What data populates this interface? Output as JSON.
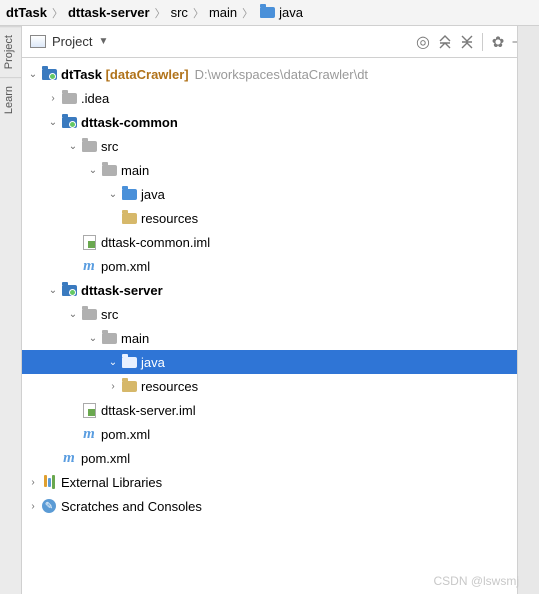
{
  "breadcrumb": [
    {
      "label": "dtTask",
      "bold": true,
      "icon": null
    },
    {
      "label": "dttask-server",
      "bold": true,
      "icon": null
    },
    {
      "label": "src",
      "bold": false,
      "icon": null
    },
    {
      "label": "main",
      "bold": false,
      "icon": null
    },
    {
      "label": "java",
      "bold": false,
      "icon": "folder-blue"
    }
  ],
  "sideTabs": [
    "Project",
    "Learn"
  ],
  "panel": {
    "title": "Project"
  },
  "tree": {
    "root": {
      "label": "dtTask",
      "bracket": "[dataCrawler]",
      "path": "D:\\workspaces\\dataCrawler\\dt"
    },
    "idea": ".idea",
    "dttask_common": "dttask-common",
    "common_src": "src",
    "common_main": "main",
    "common_java": "java",
    "common_resources": "resources",
    "common_iml": "dttask-common.iml",
    "common_pom": "pom.xml",
    "dttask_server": "dttask-server",
    "server_src": "src",
    "server_main": "main",
    "server_java": "java",
    "server_resources": "resources",
    "server_iml": "dttask-server.iml",
    "server_pom": "pom.xml",
    "root_pom": "pom.xml",
    "ext_lib": "External Libraries",
    "scratches": "Scratches and Consoles"
  },
  "watermark": "CSDN @lswsmj"
}
